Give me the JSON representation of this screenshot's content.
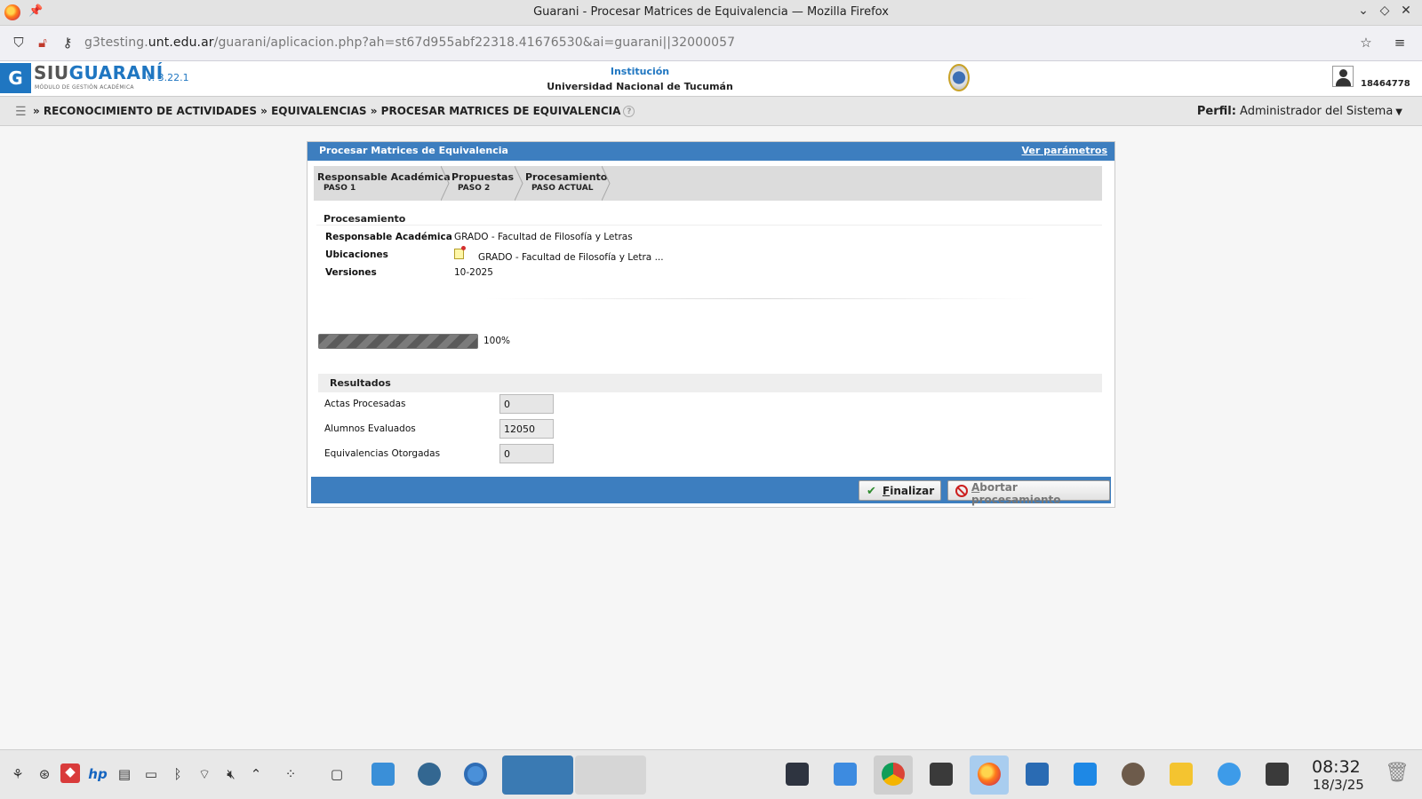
{
  "window": {
    "title": "Guarani - Procesar Matrices de Equivalencia — Mozilla Firefox"
  },
  "browser": {
    "url_prefix": "g3testing.",
    "url_domain": "unt.edu.ar",
    "url_path": "/guarani/aplicacion.php?ah=st67d955abf22318.41676530&ai=guarani||32000057"
  },
  "header": {
    "logo_g": "G",
    "logo_siu": "SIU",
    "logo_guarani": "GUARANÍ",
    "logo_subtitle": "MÓDULO DE GESTIÓN ACADÉMICA",
    "version": "v. 3.22.1",
    "institution_label": "Institución",
    "institution_name": "Universidad Nacional de Tucumán",
    "user_id": "18464778"
  },
  "breadcrumb": {
    "text": "» RECONOCIMIENTO DE ACTIVIDADES » EQUIVALENCIAS » PROCESAR MATRICES DE EQUIVALENCIA",
    "help": "?",
    "perfil_label": "Perfil:",
    "perfil_value": "Administrador del Sistema"
  },
  "panel": {
    "title": "Procesar Matrices de Equivalencia",
    "link": "Ver parámetros",
    "steps": [
      {
        "name": "Responsable Académica",
        "sub": "PASO 1"
      },
      {
        "name": "Propuestas",
        "sub": "PASO 2"
      },
      {
        "name": "Procesamiento",
        "sub": "PASO ACTUAL"
      }
    ],
    "section_title": "Procesamiento",
    "fields": {
      "responsable_label": "Responsable Académica",
      "responsable_value": "GRADO - Facultad de Filosofía y Letras",
      "ubicaciones_label": "Ubicaciones",
      "ubicaciones_value": "GRADO - Facultad de Filosofía y Letra  ...",
      "versiones_label": "Versiones",
      "versiones_value": "10-2025"
    },
    "progress": {
      "percent": 100,
      "text": "100%"
    },
    "results": {
      "title": "Resultados",
      "rows": [
        {
          "label": "Actas Procesadas",
          "value": "0"
        },
        {
          "label": "Alumnos Evaluados",
          "value": "12050"
        },
        {
          "label": "Equivalencias Otorgadas",
          "value": "0"
        }
      ]
    },
    "buttons": {
      "finalizar_first": "F",
      "finalizar_rest": "inalizar",
      "abortar_first": "A",
      "abortar_rest": "bortar procesamiento"
    }
  },
  "taskbar": {
    "time": "08:32",
    "date": "18/3/25"
  }
}
